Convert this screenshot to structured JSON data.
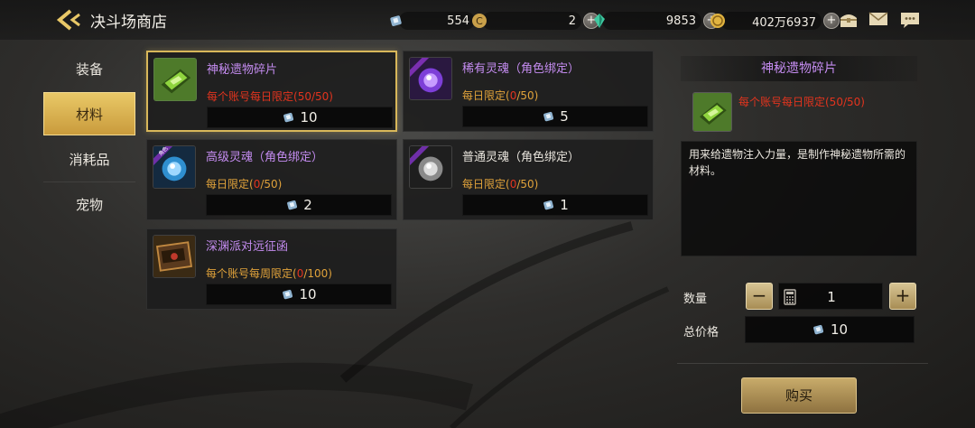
{
  "header": {
    "title": "决斗场商店",
    "currencies": [
      {
        "icon": "crystal-ticket-icon",
        "value": "554"
      },
      {
        "icon": "c-coin-icon",
        "value": "2"
      },
      {
        "icon": "green-gem-icon",
        "value": "9853"
      },
      {
        "icon": "gold-coin-icon",
        "value": "402万6937"
      }
    ],
    "icons": [
      "treasure-chest-icon",
      "mail-icon",
      "chat-icon"
    ]
  },
  "nav": {
    "items": [
      {
        "label": "装备",
        "active": false
      },
      {
        "label": "材料",
        "active": true
      },
      {
        "label": "消耗品",
        "active": false
      },
      {
        "label": "宠物",
        "active": false
      }
    ]
  },
  "items": [
    {
      "name": "神秘遗物碎片",
      "limit_prefix": "每个账号每日限定(",
      "limit_count": "50",
      "limit_suffix": "/50)",
      "limit_style": "red",
      "price": "10",
      "selected": true,
      "thumb": "green-relic-icon"
    },
    {
      "name": "稀有灵魂（角色绑定）",
      "limit_prefix": "每日限定(",
      "limit_count": "0",
      "limit_suffix": "/50)",
      "limit_style": "orange",
      "price": "5",
      "selected": false,
      "thumb": "purple-soul-icon"
    },
    {
      "name": "高级灵魂（角色绑定）",
      "limit_prefix": "每日限定(",
      "limit_count": "0",
      "limit_suffix": "/50)",
      "limit_style": "orange",
      "price": "2",
      "selected": false,
      "thumb": "blue-soul-icon"
    },
    {
      "name": "普通灵魂（角色绑定）",
      "limit_prefix": "每日限定(",
      "limit_count": "0",
      "limit_suffix": "/50)",
      "limit_style": "orange",
      "price": "1",
      "selected": false,
      "thumb": "white-soul-icon"
    },
    {
      "name": "深渊派对远征函",
      "limit_prefix": "每个账号每周限定(",
      "limit_count": "0",
      "limit_suffix": "/100)",
      "limit_style": "orange",
      "price": "10",
      "selected": false,
      "thumb": "abyss-letter-icon"
    }
  ],
  "thumb_tag": "角色",
  "detail": {
    "title": "神秘遗物碎片",
    "limit": "每个账号每日限定(50/50)",
    "description": "用来给遗物注入力量，是制作神秘遗物所需的材料。",
    "quantity_label": "数量",
    "quantity": "1",
    "total_label": "总价格",
    "total": "10",
    "buy_label": "购买"
  },
  "colors": {
    "accent": "#d8b75a",
    "item_name": "#c48cf0",
    "limit_red": "#e2341e",
    "limit_orange": "#e0a23a"
  }
}
